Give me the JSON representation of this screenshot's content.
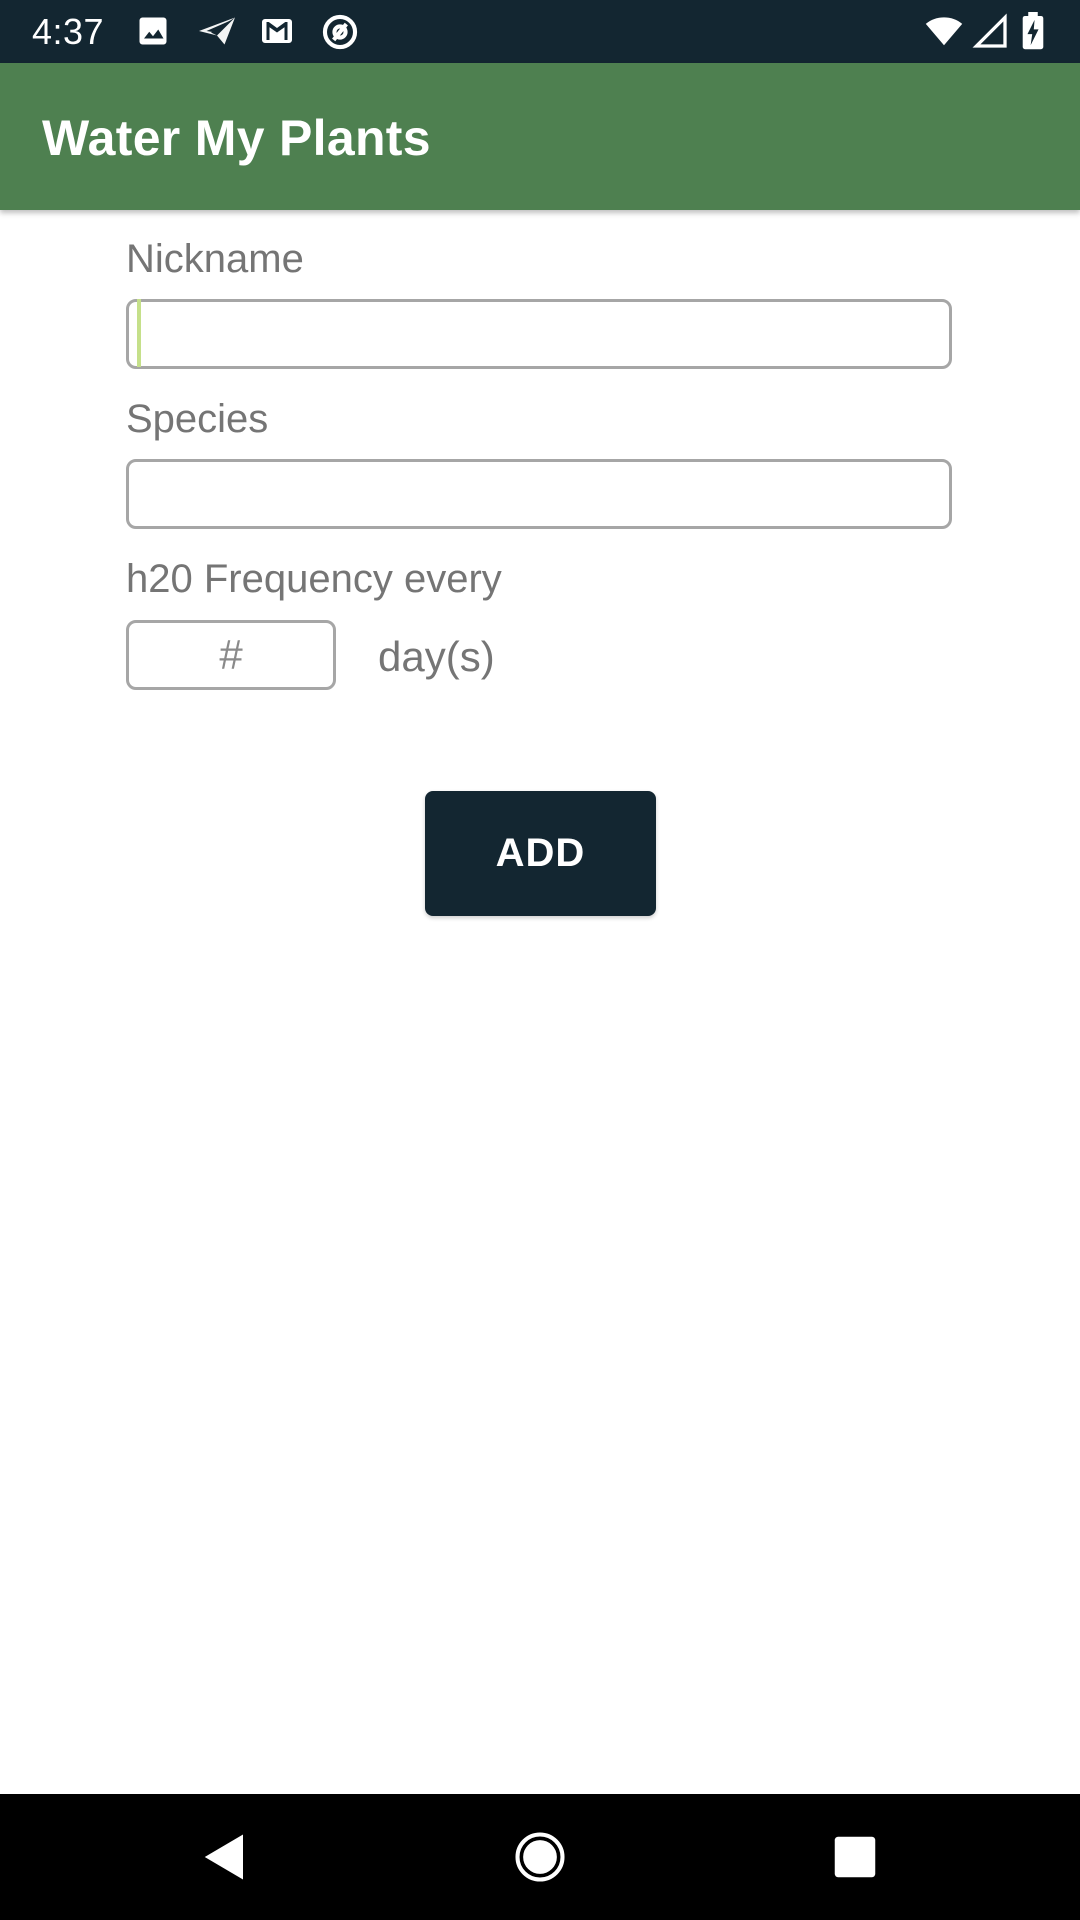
{
  "status_bar": {
    "time": "4:37",
    "left_icons": [
      "image-icon",
      "send-icon",
      "gmail-icon",
      "at-sign-icon"
    ],
    "right_icons": [
      "wifi-icon",
      "signal-icon",
      "battery-charging-icon"
    ]
  },
  "app_bar": {
    "title": "Water My Plants",
    "color": "#4e8050"
  },
  "form": {
    "nickname_label": "Nickname",
    "nickname_value": "",
    "species_label": "Species",
    "species_value": "",
    "frequency_label": "h20 Frequency every",
    "frequency_placeholder": "#",
    "frequency_value": "",
    "days_label": "day(s)"
  },
  "actions": {
    "add_label": "ADD",
    "button_color": "#132631"
  },
  "nav_bar": {
    "buttons": [
      "back-icon",
      "home-icon",
      "recents-icon"
    ]
  }
}
